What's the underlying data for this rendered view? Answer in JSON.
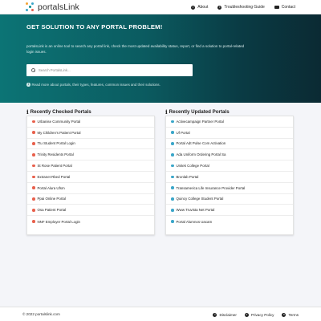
{
  "header": {
    "logo_text": "portalsLink",
    "nav": [
      {
        "label": "About",
        "icon": "info-icon"
      },
      {
        "label": "Troubleshooting Guide",
        "icon": "help-icon"
      },
      {
        "label": "Contact",
        "icon": "mail-icon"
      }
    ]
  },
  "hero": {
    "title": "GET SOLUTION TO ANY PORTAL PROBLEM!",
    "description": "portalsLink is an online tool to search any portal link, check the most updated availability status, report, or find a solution to portal-related login issues.",
    "search_placeholder": "Search PortalsLink...",
    "more_text": "Read more about portals, their types, features, common issues and their solutions."
  },
  "recently_checked": {
    "title": "Recently Checked Portals",
    "items": [
      {
        "label": "Urbanise Community Portal",
        "color": "#e8604c"
      },
      {
        "label": "My Children's Patient Portal",
        "color": "#e8604c"
      },
      {
        "label": "Ttu Student Portal Login",
        "color": "#e8604c"
      },
      {
        "label": "Trinity Residents Portal",
        "color": "#e8604c"
      },
      {
        "label": "St Rose Patient Portal",
        "color": "#e8604c"
      },
      {
        "label": "Extranet Rbed Portal",
        "color": "#e8604c"
      },
      {
        "label": "Portal Alura Ufsm",
        "color": "#e8604c"
      },
      {
        "label": "Ppai Online Portal",
        "color": "#e8604c"
      },
      {
        "label": "Osa Patient Portal",
        "color": "#e8604c"
      },
      {
        "label": "NNF Employer Portal Login",
        "color": "#e8604c"
      }
    ]
  },
  "recently_updated": {
    "title": "Recently Updated Portals",
    "items": [
      {
        "label": "Activecampaign Partner Portal",
        "color": "#3aa6c9"
      },
      {
        "label": "Uf Portal",
        "color": "#3aa6c9"
      },
      {
        "label": "Portal Adt Pulse Com Activation",
        "color": "#3aa6c9"
      },
      {
        "label": "Ada Uniform Ordering Portal Sa",
        "color": "#3aa6c9"
      },
      {
        "label": "Unitek College Portal",
        "color": "#3aa6c9"
      },
      {
        "label": "Bronlab Portal",
        "color": "#3aa6c9"
      },
      {
        "label": "Transamerica Life Insurance Provider Portal",
        "color": "#3aa6c9"
      },
      {
        "label": "Quincy College Student Portal",
        "color": "#3aa6c9"
      },
      {
        "label": "Www Truvista Net Portal",
        "color": "#3aa6c9"
      },
      {
        "label": "Portal Alumnos Uacam",
        "color": "#3aa6c9"
      }
    ]
  },
  "footer": {
    "copyright": "© 2022 portalslink.com",
    "links": [
      {
        "label": "Disclaimer",
        "icon": "info-icon"
      },
      {
        "label": "Privacy Policy",
        "icon": "shield-icon"
      },
      {
        "label": "Terms",
        "icon": "document-icon"
      }
    ]
  }
}
